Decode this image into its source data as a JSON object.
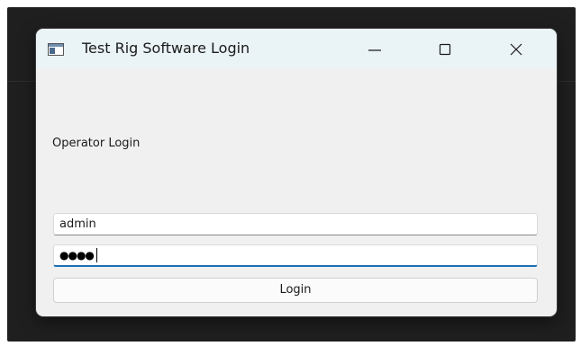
{
  "window": {
    "title": "Test Rig Software Login",
    "controls": {
      "minimize_icon": "minimize-icon",
      "maximize_icon": "maximize-icon",
      "close_icon": "close-icon"
    },
    "app_icon": "app-window-icon"
  },
  "form": {
    "heading": "Operator Login",
    "username": {
      "value": "admin"
    },
    "password": {
      "masked_value": "●●●●"
    },
    "login_button": "Login"
  },
  "colors": {
    "titlebar": "#eaf3f6",
    "window_bg": "#f0f0f0",
    "desktop_bg": "#1f1f1f",
    "focus_accent": "#1a6fb5"
  }
}
